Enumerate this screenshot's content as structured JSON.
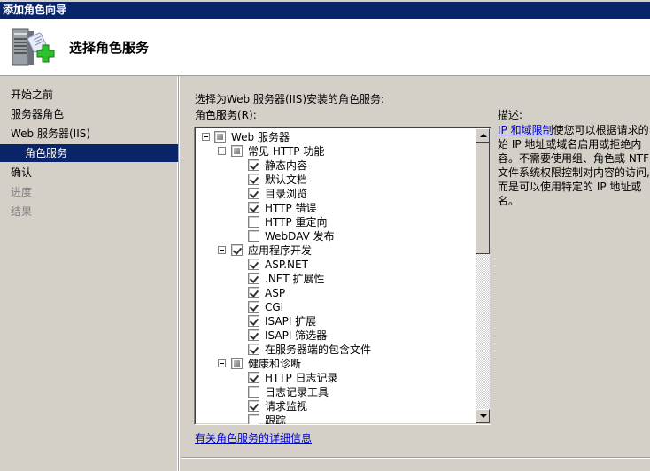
{
  "window": {
    "title": "添加角色向导"
  },
  "header": {
    "title": "选择角色服务",
    "icon": "server-add-icon"
  },
  "sidebar": {
    "items": [
      {
        "label": "开始之前",
        "state": "normal"
      },
      {
        "label": "服务器角色",
        "state": "normal"
      },
      {
        "label": "Web 服务器(IIS)",
        "state": "normal"
      },
      {
        "label": "角色服务",
        "state": "selected"
      },
      {
        "label": "确认",
        "state": "normal"
      },
      {
        "label": "进度",
        "state": "disabled"
      },
      {
        "label": "结果",
        "state": "disabled"
      }
    ]
  },
  "main": {
    "intro": "选择为Web 服务器(IIS)安装的角色服务:",
    "list_label": "角色服务(R):",
    "tree": [
      {
        "label": "Web 服务器",
        "level": 0,
        "expander": true,
        "state": "partial"
      },
      {
        "label": "常见 HTTP 功能",
        "level": 1,
        "expander": true,
        "state": "partial"
      },
      {
        "label": "静态内容",
        "level": 2,
        "state": "checked"
      },
      {
        "label": "默认文档",
        "level": 2,
        "state": "checked"
      },
      {
        "label": "目录浏览",
        "level": 2,
        "state": "checked"
      },
      {
        "label": "HTTP 错误",
        "level": 2,
        "state": "checked"
      },
      {
        "label": "HTTP 重定向",
        "level": 2,
        "state": "unchecked"
      },
      {
        "label": "WebDAV 发布",
        "level": 2,
        "state": "unchecked"
      },
      {
        "label": "应用程序开发",
        "level": 1,
        "expander": true,
        "state": "checked"
      },
      {
        "label": "ASP.NET",
        "level": 2,
        "state": "checked"
      },
      {
        "label": ".NET 扩展性",
        "level": 2,
        "state": "checked"
      },
      {
        "label": "ASP",
        "level": 2,
        "state": "checked"
      },
      {
        "label": "CGI",
        "level": 2,
        "state": "checked"
      },
      {
        "label": "ISAPI 扩展",
        "level": 2,
        "state": "checked"
      },
      {
        "label": "ISAPI 筛选器",
        "level": 2,
        "state": "checked"
      },
      {
        "label": "在服务器端的包含文件",
        "level": 2,
        "state": "checked"
      },
      {
        "label": "健康和诊断",
        "level": 1,
        "expander": true,
        "state": "partial"
      },
      {
        "label": "HTTP 日志记录",
        "level": 2,
        "state": "checked"
      },
      {
        "label": "日志记录工具",
        "level": 2,
        "state": "unchecked"
      },
      {
        "label": "请求监视",
        "level": 2,
        "state": "checked"
      },
      {
        "label": "跟踪",
        "level": 2,
        "state": "unchecked"
      }
    ],
    "scroll_position": 0,
    "more_link": "有关角色服务的详细信息"
  },
  "description": {
    "title": "描述:",
    "link": "IP 和域限制",
    "text_lines": [
      "使您可以根据请求的",
      "始 IP 地址或域名启用或拒绝内",
      "容。不需要使用组、角色或 NTF",
      "文件系统权限控制对内容的访问,",
      "而是可以使用特定的 IP 地址或",
      "名。"
    ]
  }
}
